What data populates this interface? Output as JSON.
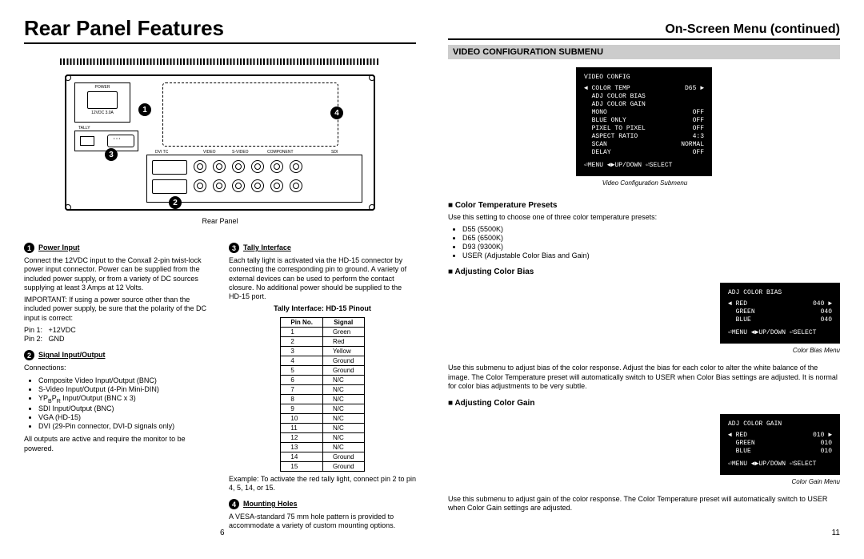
{
  "left": {
    "title": "Rear Panel Features",
    "diagram_caption": "Rear Panel",
    "power_label": "POWER",
    "power_sub": "12VDC 3.0A",
    "tally_label": "TALLY",
    "io_labels": {
      "dvi": "DVI TC",
      "video": "VIDEO",
      "svideo": "S-VIDEO",
      "comp": "COMPONENT",
      "sdi": "SDI"
    },
    "sections": {
      "s1": {
        "num": "1",
        "title": "Power Input",
        "p1": "Connect the 12VDC input to the Conxall 2-pin twist-lock power input connector. Power can be supplied from the included power supply, or from a variety of DC sources supplying at least 3 Amps at 12 Volts.",
        "p2": "IMPORTANT: If using a power source other than the included power supply, be sure that the polarity of the DC input is correct:",
        "pins": "Pin 1:   +12VDC\nPin 2:   GND"
      },
      "s2": {
        "num": "2",
        "title": "Signal Input/Output",
        "p1": "Connections:",
        "items": [
          "Composite Video Input/Output (BNC)",
          "S-Video Input/Output (4-Pin Mini-DIN)",
          "YP_BP_R Input/Output (BNC x 3)",
          "SDI Input/Output (BNC)",
          "VGA (HD-15)",
          "DVI (29-Pin connector, DVI-D signals only)"
        ],
        "p2": "All outputs are active and require the monitor to be powered."
      },
      "s3": {
        "num": "3",
        "title": "Tally Interface",
        "p1": "Each tally light is activated via the HD-15 connector by connecting the corresponding pin to ground. A variety of external devices can be used to perform the contact closure. No additional power should be supplied to the HD-15 port.",
        "table_title": "Tally Interface: HD-15 Pinout",
        "th1": "Pin No.",
        "th2": "Signal",
        "rows": [
          [
            "1",
            "Green"
          ],
          [
            "2",
            "Red"
          ],
          [
            "3",
            "Yellow"
          ],
          [
            "4",
            "Ground"
          ],
          [
            "5",
            "Ground"
          ],
          [
            "6",
            "N/C"
          ],
          [
            "7",
            "N/C"
          ],
          [
            "8",
            "N/C"
          ],
          [
            "9",
            "N/C"
          ],
          [
            "10",
            "N/C"
          ],
          [
            "11",
            "N/C"
          ],
          [
            "12",
            "N/C"
          ],
          [
            "13",
            "N/C"
          ],
          [
            "14",
            "Ground"
          ],
          [
            "15",
            "Ground"
          ]
        ],
        "p2": "Example: To activate the red tally light, connect pin 2 to pin 4, 5, 14, or 15."
      },
      "s4": {
        "num": "4",
        "title": "Mounting Holes",
        "p1": "A VESA-standard 75 mm hole pattern is provided to accommodate a variety of custom mounting options."
      }
    },
    "page_num": "6"
  },
  "right": {
    "title": "On-Screen Menu (continued)",
    "subtitle": "VIDEO CONFIGURATION SUBMENU",
    "osd1": {
      "title": "VIDEO CONFIG",
      "rows": [
        [
          "COLOR TEMP",
          "D65",
          true
        ],
        [
          "ADJ COLOR BIAS",
          "",
          false
        ],
        [
          "ADJ COLOR GAIN",
          "",
          false
        ],
        [
          "MONO",
          "OFF",
          false
        ],
        [
          "BLUE ONLY",
          "OFF",
          false
        ],
        [
          "PIXEL TO PIXEL",
          "OFF",
          false
        ],
        [
          "ASPECT RATIO",
          "4:3",
          false
        ],
        [
          "SCAN",
          "NORMAL",
          false
        ],
        [
          "DELAY",
          "OFF",
          false
        ]
      ],
      "footer": "⏎MENU ◄►UP/DOWN ⏎SELECT",
      "caption": "Video Configuration Submenu"
    },
    "sec1": {
      "title": "Color Temperature Presets",
      "p1": "Use this setting to choose one of three color temperature presets:",
      "items": [
        "D55 (5500K)",
        "D65 (6500K)",
        "D93 (9300K)",
        "USER (Adjustable Color Bias and Gain)"
      ]
    },
    "sec2": {
      "title": "Adjusting Color Bias",
      "osd": {
        "title": "ADJ COLOR BIAS",
        "rows": [
          [
            "RED",
            "040",
            true
          ],
          [
            "GREEN",
            "040",
            false
          ],
          [
            "BLUE",
            "040",
            false
          ]
        ],
        "footer": "⏎MENU ◄►UP/DOWN ⏎SELECT",
        "caption": "Color Bias Menu"
      },
      "p1": "Use this submenu to adjust bias of the color response. Adjust the bias for each color to alter the white balance of the image. The Color Temperature preset will automatically switch to USER when Color Bias settings are adjusted. It is normal for color bias adjustments to be very subtle."
    },
    "sec3": {
      "title": "Adjusting Color Gain",
      "osd": {
        "title": "ADJ COLOR GAIN",
        "rows": [
          [
            "RED",
            "010",
            true
          ],
          [
            "GREEN",
            "010",
            false
          ],
          [
            "BLUE",
            "010",
            false
          ]
        ],
        "footer": "⏎MENU ◄►UP/DOWN ⏎SELECT",
        "caption": "Color Gain Menu"
      },
      "p1": "Use this submenu to adjust gain of the color response. The Color Temperature preset will automatically switch to USER when Color Gain settings are adjusted."
    },
    "page_num": "11"
  }
}
